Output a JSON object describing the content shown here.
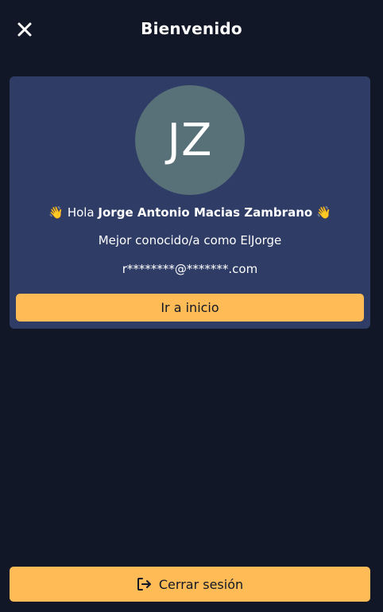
{
  "header": {
    "title": "Bienvenido",
    "close_icon": "close-icon"
  },
  "profile": {
    "initials": "JZ",
    "greeting_prefix": "Hola",
    "full_name": "Jorge Antonio Macias Zambrano",
    "wave_emoji": "👋",
    "nickname_text": "Mejor conocido/a como ElJorge",
    "email_masked": "r********@*******.com"
  },
  "actions": {
    "home_label": "Ir a inicio",
    "logout_label": "Cerrar sesión",
    "logout_icon": "sign-out-icon"
  },
  "colors": {
    "background": "#111726",
    "card": "#2f3c66",
    "avatar": "#587078",
    "accent": "#ffbb55"
  }
}
